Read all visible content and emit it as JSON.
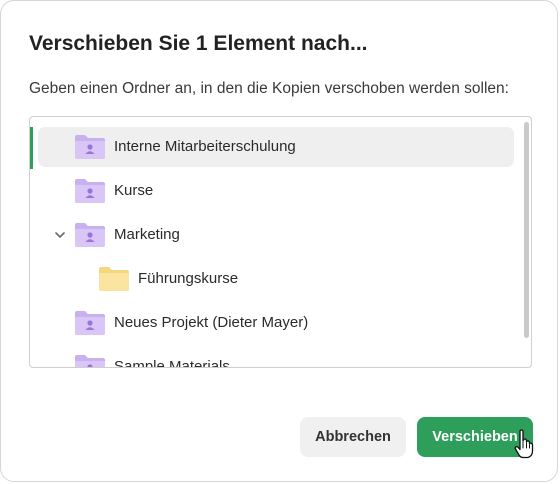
{
  "dialog": {
    "title": "Verschieben Sie 1 Element nach...",
    "description": "Geben einen Ordner an, in den die Kopien verschoben werden sollen:"
  },
  "tree": {
    "items": [
      {
        "label": "Interne Mitarbeiterschulung",
        "icon": "shared-folder-icon",
        "selected": true
      },
      {
        "label": "Kurse",
        "icon": "shared-folder-icon",
        "selected": false
      },
      {
        "label": "Marketing",
        "icon": "shared-folder-icon",
        "expanded": true
      },
      {
        "label": "Führungskurse",
        "icon": "folder-icon",
        "level": 1
      },
      {
        "label": "Neues Projekt (Dieter Mayer)",
        "icon": "shared-folder-icon"
      },
      {
        "label": "Sample Materials",
        "icon": "shared-folder-icon"
      }
    ]
  },
  "buttons": {
    "cancel_label": "Abbrechen",
    "confirm_label": "Verschieben"
  },
  "colors": {
    "accent": "#2e9e5b",
    "shared_folder": "#c9b0f0",
    "plain_folder": "#fbe3a0"
  }
}
